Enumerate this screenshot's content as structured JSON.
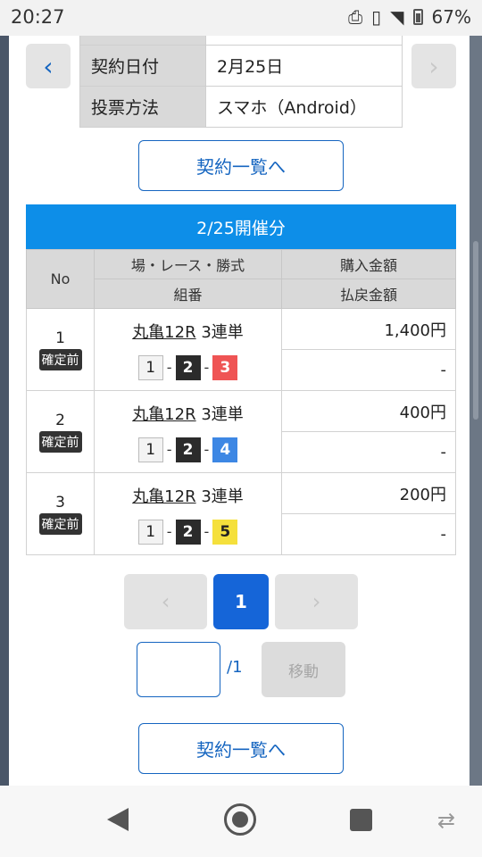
{
  "status_bar": {
    "time": "20:27",
    "battery": "67%",
    "icons": [
      "nfc-icon",
      "vibrate-icon",
      "wifi-icon",
      "battery-icon"
    ]
  },
  "contract_info": {
    "rows": [
      {
        "key": "契約日付",
        "value": "2月25日"
      },
      {
        "key": "投票方法",
        "value": "スマホ（Android）"
      }
    ]
  },
  "top_button": {
    "label": "契約一覧へ"
  },
  "section": {
    "title": "2/25開催分"
  },
  "table": {
    "headers": {
      "no": "No",
      "race": "場・レース・勝式",
      "purchase": "購入金額",
      "combo": "組番",
      "payout": "払戻金額"
    },
    "rows": [
      {
        "no": "1",
        "status": "確定前",
        "place": "丸亀12R",
        "type": "3連単",
        "combo": [
          "1",
          "2",
          "3"
        ],
        "purchase": "1,400円",
        "payout": "-"
      },
      {
        "no": "2",
        "status": "確定前",
        "place": "丸亀12R",
        "type": "3連単",
        "combo": [
          "1",
          "2",
          "4"
        ],
        "purchase": "400円",
        "payout": "-"
      },
      {
        "no": "3",
        "status": "確定前",
        "place": "丸亀12R",
        "type": "3連単",
        "combo": [
          "1",
          "2",
          "5"
        ],
        "purchase": "200円",
        "payout": "-"
      }
    ]
  },
  "pagination": {
    "current": "1",
    "total_label": "/1",
    "move_label": "移動"
  },
  "bottom_button": {
    "label": "契約一覧へ"
  },
  "colors": {
    "accent": "#1565c0",
    "header_blue": "#0d8ee8",
    "lane_white": "#f3f3f3",
    "lane_black": "#2b2b2b",
    "lane_red": "#ef5454",
    "lane_blue": "#3d87e4",
    "lane_yellow": "#f5e03c"
  }
}
